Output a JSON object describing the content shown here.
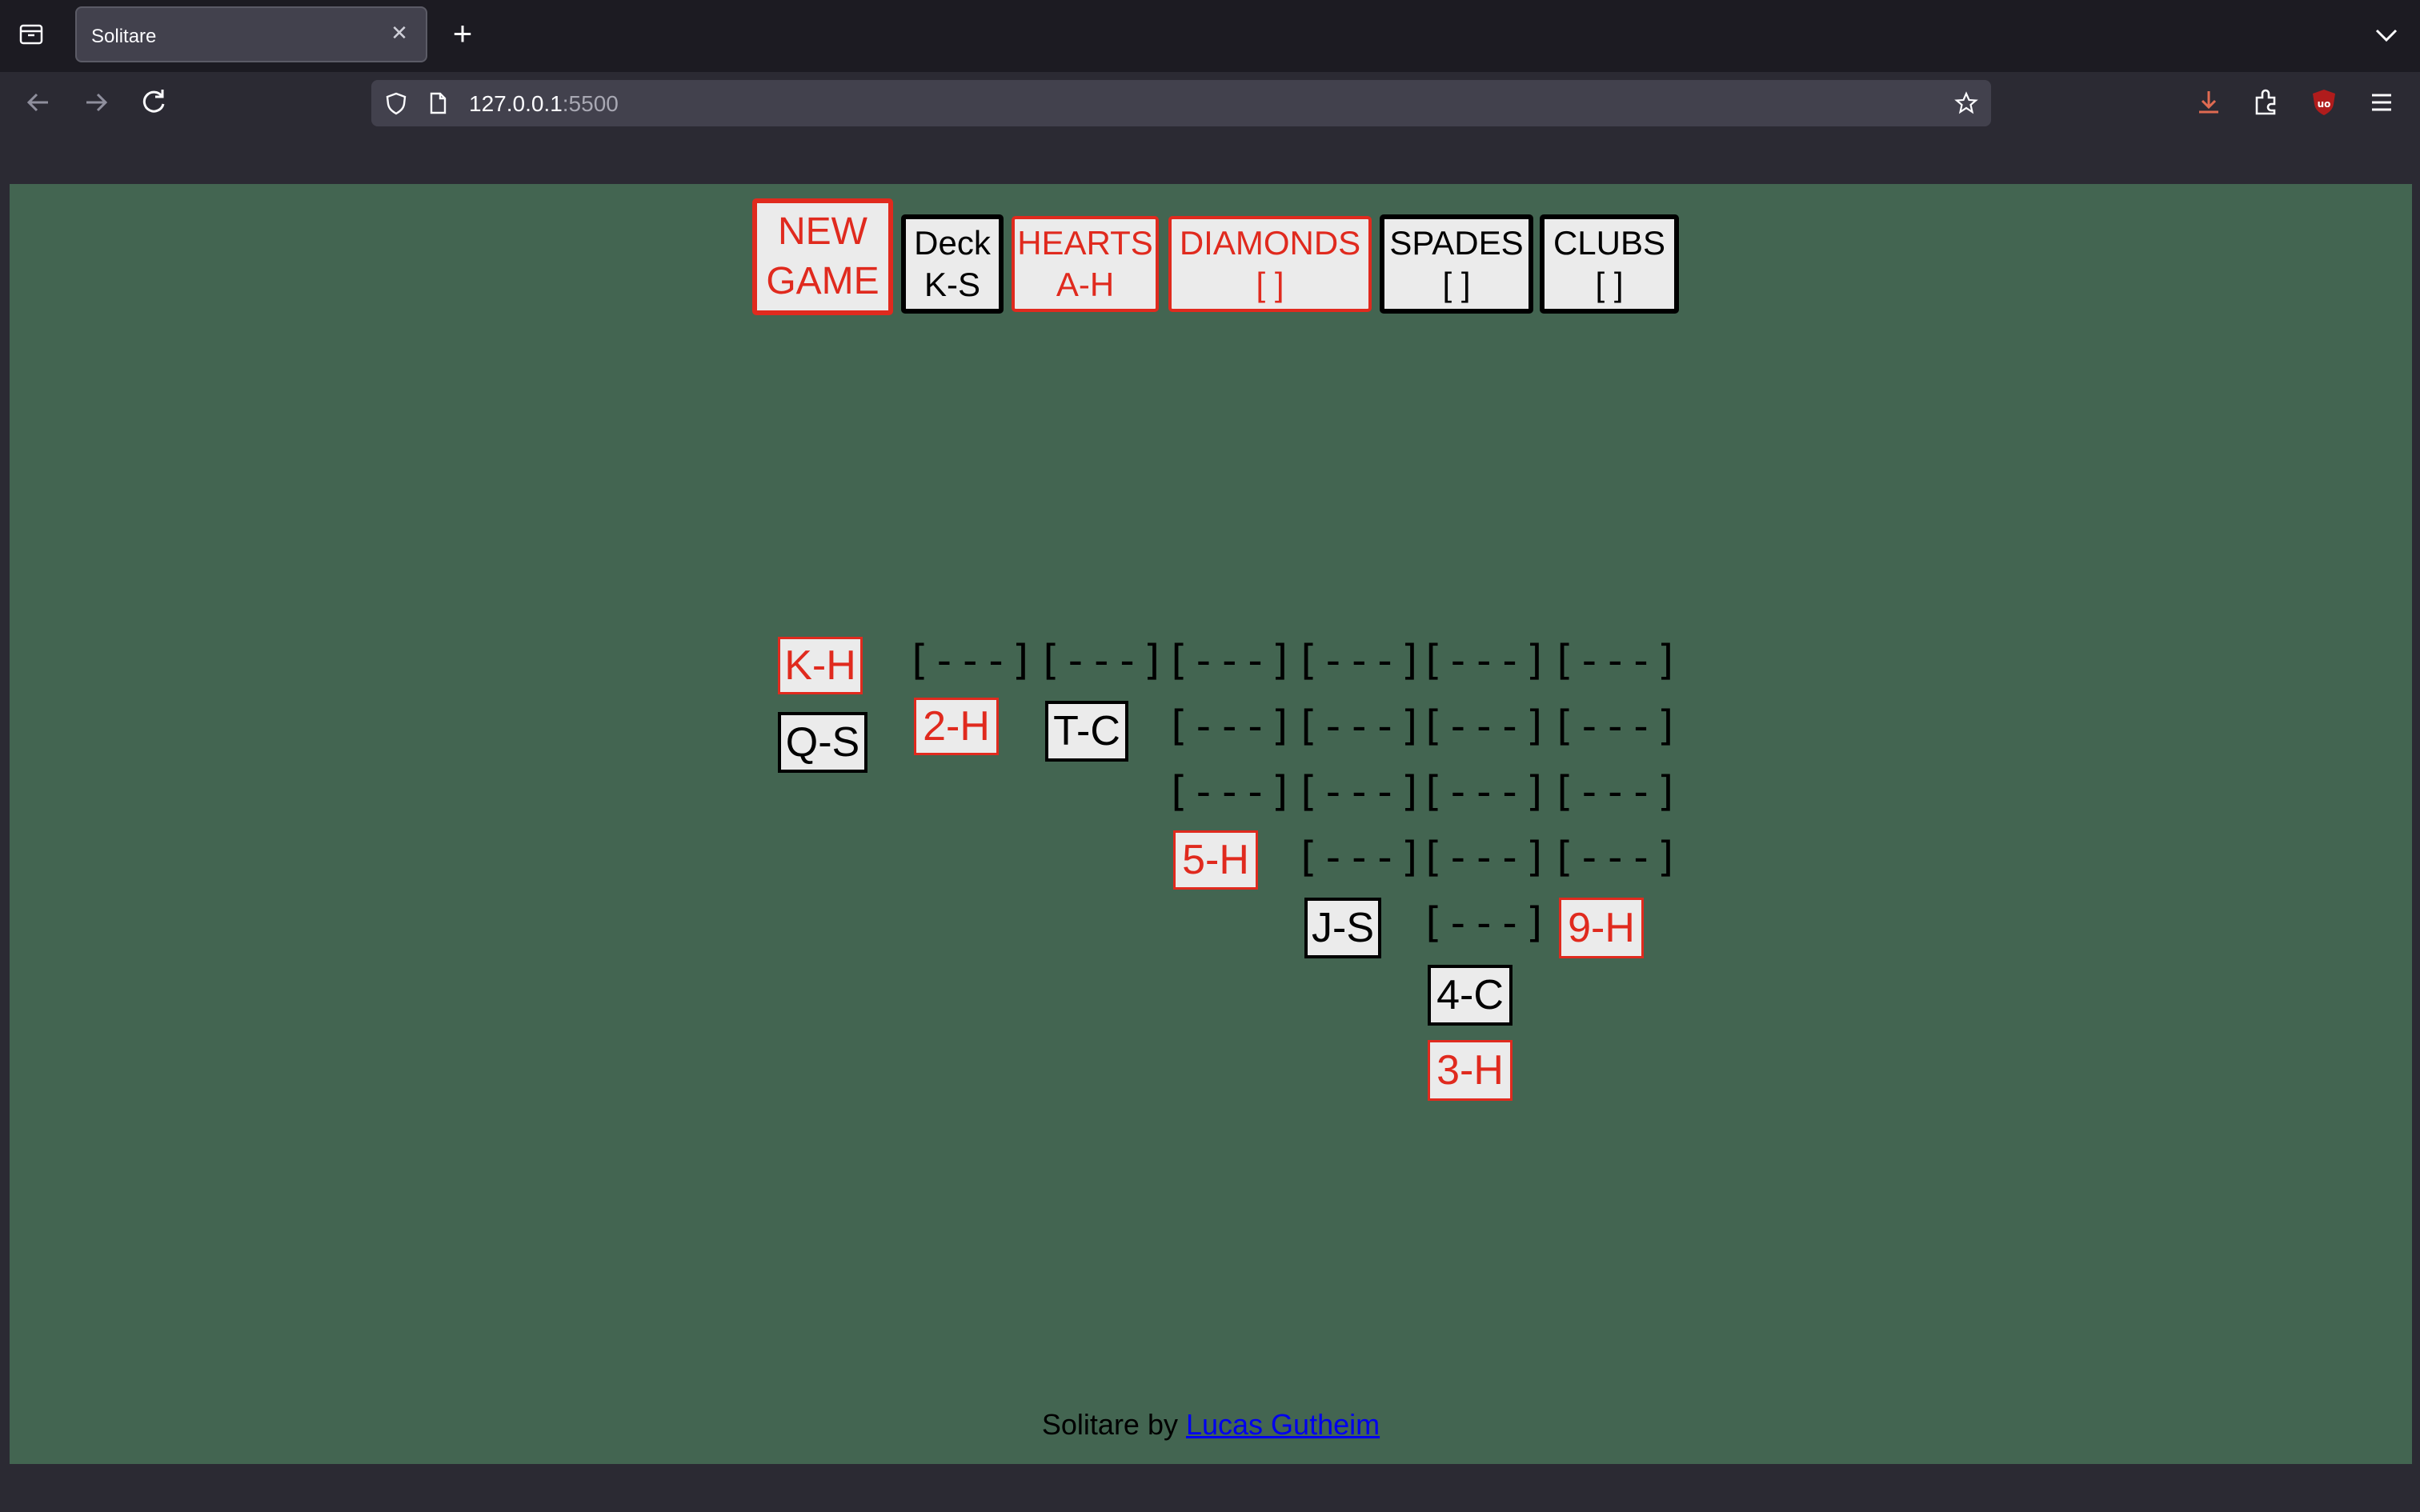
{
  "browser": {
    "tab_title": "Solitare",
    "url_host": "127.0.0.1",
    "url_port": ":5500"
  },
  "game": {
    "new_game": [
      "NEW",
      "GAME"
    ],
    "deck": [
      "Deck",
      "K-S"
    ],
    "foundations": [
      {
        "suit": "HEARTS",
        "value": "A-H",
        "color": "#e02a1e"
      },
      {
        "suit": "DIAMONDS",
        "value": "[ ]",
        "color": "#e02a1e"
      },
      {
        "suit": "SPADES",
        "value": "[ ]",
        "color": "#000000"
      },
      {
        "suit": "CLUBS",
        "value": "[ ]",
        "color": "#000000"
      }
    ],
    "hidden_label": "[---]",
    "tableau": [
      {
        "hidden": 0,
        "cards": [
          {
            "label": "K-H",
            "red": true
          },
          {
            "label": "Q-S",
            "red": false
          }
        ]
      },
      {
        "hidden": 1,
        "cards": [
          {
            "label": "2-H",
            "red": true
          }
        ]
      },
      {
        "hidden": 1,
        "cards": [
          {
            "label": "T-C",
            "red": false
          }
        ]
      },
      {
        "hidden": 3,
        "cards": [
          {
            "label": "5-H",
            "red": true
          }
        ]
      },
      {
        "hidden": 4,
        "cards": [
          {
            "label": "J-S",
            "red": false
          }
        ]
      },
      {
        "hidden": 5,
        "cards": [
          {
            "label": "4-C",
            "red": false
          },
          {
            "label": "3-H",
            "red": true
          }
        ]
      },
      {
        "hidden": 4,
        "cards": [
          {
            "label": "9-H",
            "red": true
          }
        ]
      }
    ]
  },
  "footer": {
    "prefix": "Solitare by ",
    "author": "Lucas Gutheim"
  },
  "colors": {
    "table_green": "#436551",
    "red": "#e02a1e",
    "card_bg": "#ebebeb"
  }
}
